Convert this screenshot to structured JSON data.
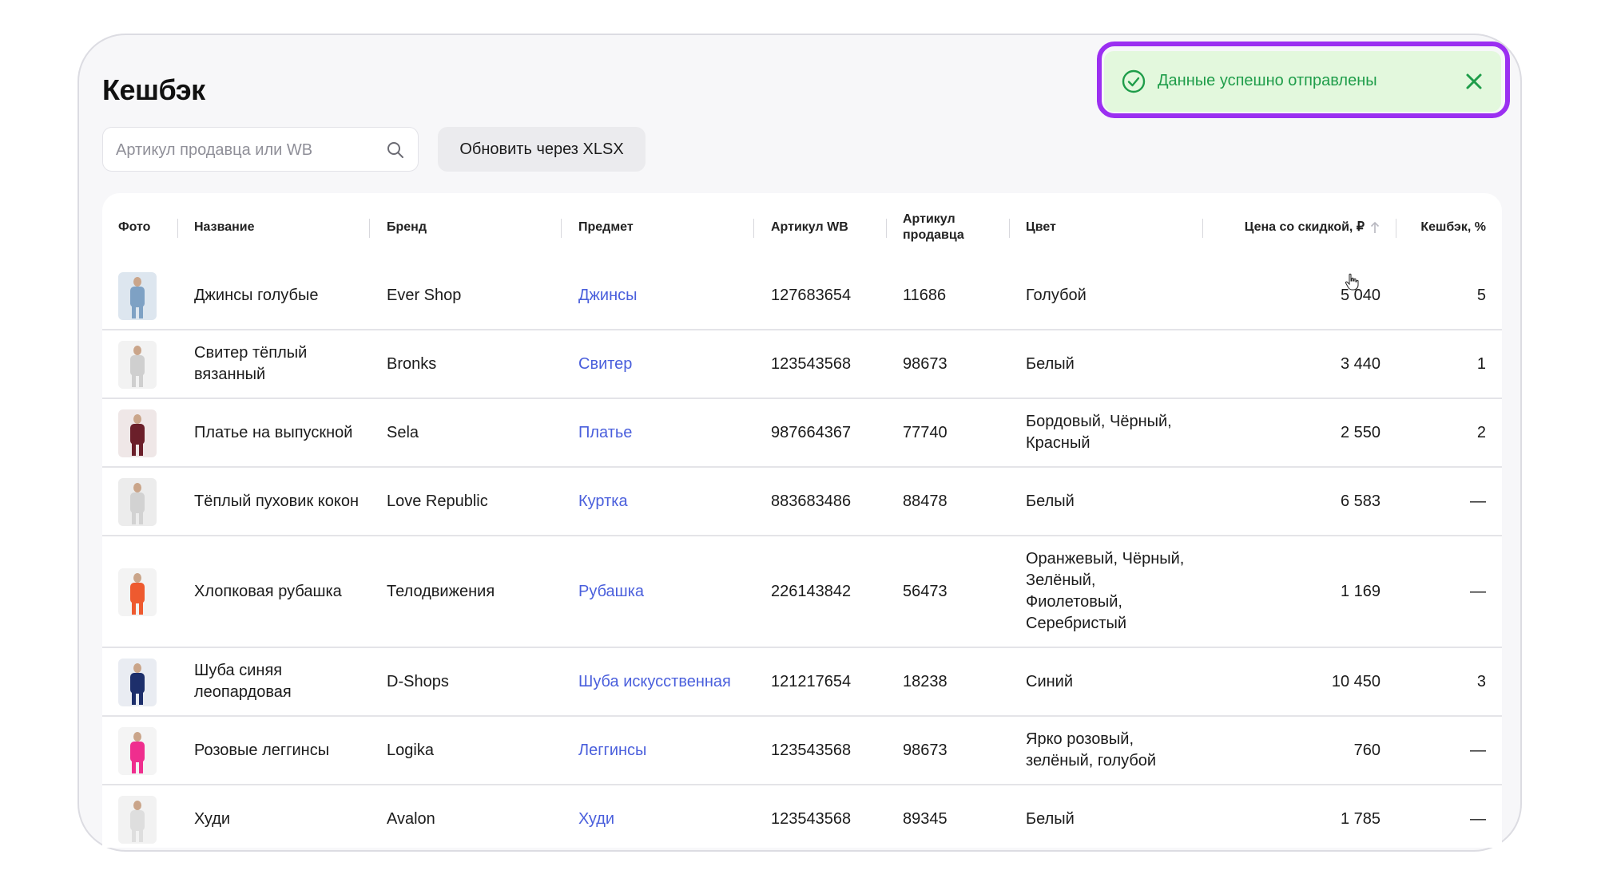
{
  "page": {
    "title": "Кешбэк"
  },
  "search": {
    "placeholder": "Артикул продавца или WB",
    "icon": "search-icon"
  },
  "toolbar": {
    "xlsx_label": "Обновить через XLSX"
  },
  "toast": {
    "message": "Данные успешно отправлены",
    "icon": "check-circle-icon",
    "close_icon": "close-icon",
    "highlight_color": "#9b2ff1",
    "background": "#e3f8dd",
    "text_color": "#1f9d4a"
  },
  "table": {
    "headers": {
      "photo": "Фото",
      "name": "Название",
      "brand": "Бренд",
      "subject": "Предмет",
      "article_wb": "Артикул WB",
      "article_seller": "Артикул продавца",
      "color": "Цвет",
      "price": "Цена со скидкой, ₽",
      "cashback": "Кешбэк, %"
    },
    "sort": {
      "column": "price",
      "direction": "asc"
    },
    "link_color": "#4a5fdc",
    "rows": [
      {
        "name": "Джинсы голубые",
        "brand": "Ever Shop",
        "subject": "Джинсы",
        "article_wb": "127683654",
        "article_seller": "11686",
        "color": "Голубой",
        "price": "5 040",
        "cashback": "5"
      },
      {
        "name": "Свитер тёплый вязанный",
        "brand": "Bronks",
        "subject": "Свитер",
        "article_wb": "123543568",
        "article_seller": "98673",
        "color": "Белый",
        "price": "3 440",
        "cashback": "1"
      },
      {
        "name": "Платье на выпускной",
        "brand": "Sela",
        "subject": "Платье",
        "article_wb": "987664367",
        "article_seller": "77740",
        "color": "Бордовый, Чёрный, Красный",
        "price": "2 550",
        "cashback": "2"
      },
      {
        "name": "Тёплый пуховик кокон",
        "brand": "Love Republic",
        "subject": "Куртка",
        "article_wb": "883683486",
        "article_seller": "88478",
        "color": "Белый",
        "price": "6 583",
        "cashback": "—"
      },
      {
        "name": "Хлопковая рубашка",
        "brand": "Телодвижения",
        "subject": "Рубашка",
        "article_wb": "226143842",
        "article_seller": "56473",
        "color": "Оранжевый, Чёрный, Зелёный, Фиолетовый, Серебристый",
        "price": "1 169",
        "cashback": "—"
      },
      {
        "name": "Шуба синяя леопардовая",
        "brand": "D-Shops",
        "subject": "Шуба искусственная",
        "article_wb": "121217654",
        "article_seller": "18238",
        "color": "Синий",
        "price": "10 450",
        "cashback": "3"
      },
      {
        "name": "Розовые леггинсы",
        "brand": "Logika",
        "subject": "Леггинсы",
        "article_wb": "123543568",
        "article_seller": "98673",
        "color": "Ярко розовый, зелёный, голубой",
        "price": "760",
        "cashback": "—"
      },
      {
        "name": "Худи",
        "brand": "Avalon",
        "subject": "Худи",
        "article_wb": "123543568",
        "article_seller": "89345",
        "color": "Белый",
        "price": "1 785",
        "cashback": "—"
      }
    ]
  }
}
